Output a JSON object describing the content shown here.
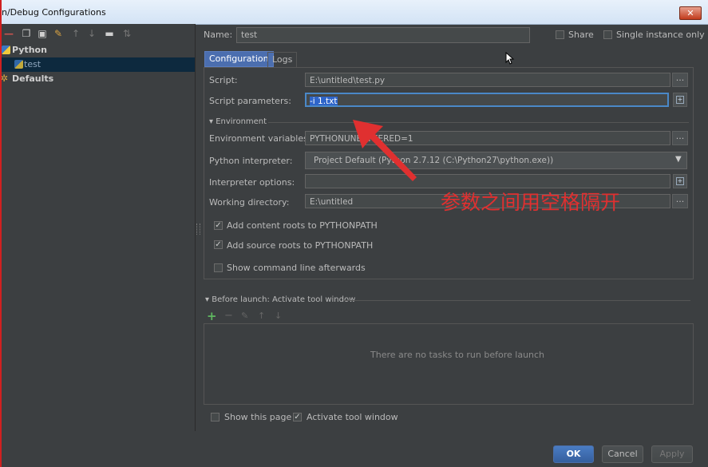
{
  "window": {
    "title": "n/Debug Configurations",
    "close_label": "✕"
  },
  "name_row": {
    "label": "Name:",
    "value": "test",
    "share_label": "Share",
    "single_label": "Single instance only"
  },
  "tree": {
    "group": "Python",
    "item": "test",
    "defaults": "Defaults"
  },
  "tabs": [
    {
      "label": "Configuration",
      "active": true
    },
    {
      "label": "Logs",
      "active": false
    }
  ],
  "config": {
    "script_label": "Script:",
    "script_value": "E:\\untitled\\test.py",
    "params_label": "Script parameters:",
    "params_value": "-i 1.txt",
    "environment_label": "Environment",
    "env_vars_label": "Environment variables:",
    "env_vars_value": "PYTHONUNBUFFERED=1",
    "interpreter_label": "Python interpreter:",
    "interpreter_value": "Project Default (Python 2.7.12 (C:\\Python27\\python.exe))",
    "interp_options_label": "Interpreter options:",
    "interp_options_value": "",
    "workdir_label": "Working directory:",
    "workdir_value": "E:\\untitled",
    "add_content_label": "Add content roots to PYTHONPATH",
    "add_source_label": "Add source roots to PYTHONPATH",
    "show_cmd_label": "Show command line afterwards"
  },
  "annotation": {
    "text": "参数之间用空格隔开"
  },
  "before_launch": {
    "title": "Before launch: Activate tool window",
    "empty_text": "There are no tasks to run before launch"
  },
  "bottom": {
    "show_page_label": "Show this page",
    "activate_label": "Activate tool window"
  },
  "buttons": {
    "ok": "OK",
    "cancel": "Cancel",
    "apply": "Apply"
  },
  "colors": {
    "accent": "#4b6eaf",
    "annotation": "#e03030",
    "selection": "#0d293e"
  }
}
